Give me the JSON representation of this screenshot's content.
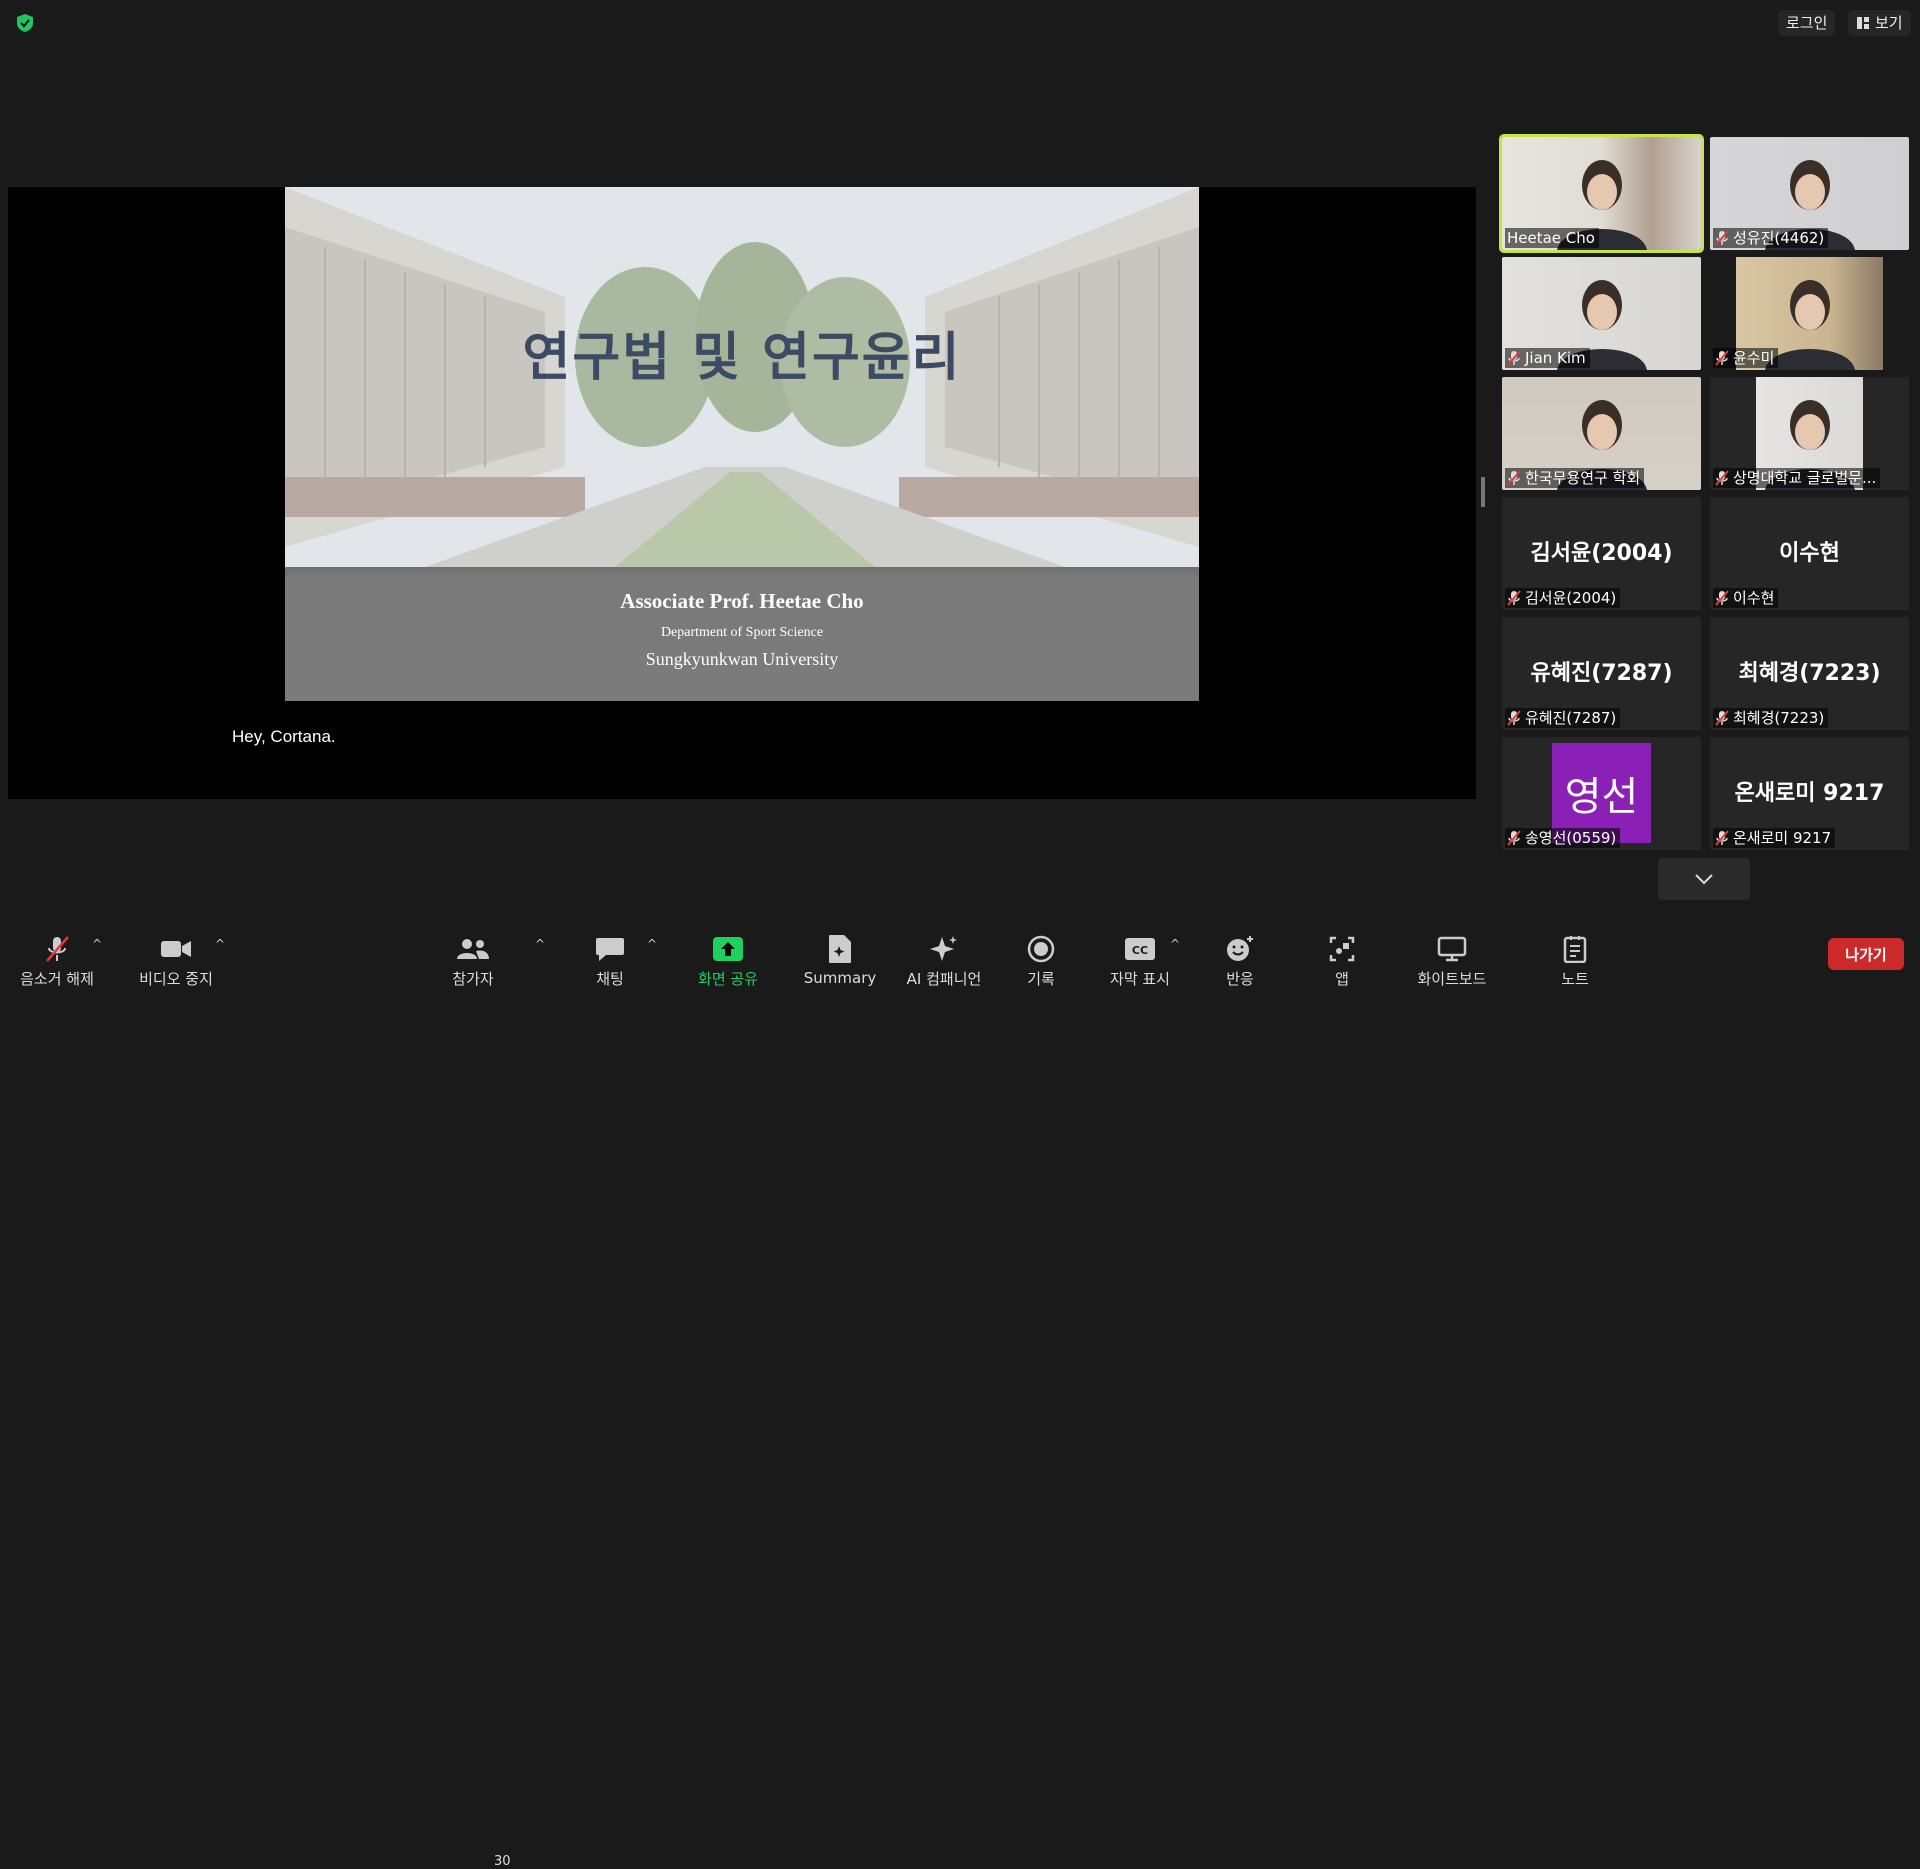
{
  "top": {
    "login_label": "로그인",
    "view_label": "보기"
  },
  "share": {
    "slide_title": "연구법 및 연구윤리",
    "prof": "Associate Prof. Heetae Cho",
    "dept": "Department of Sport Science",
    "univ": "Sungkyunkwan University",
    "caption": "Hey, Cortana."
  },
  "participants": [
    {
      "name": "Heetae Cho",
      "muted": false,
      "video": true,
      "active": true
    },
    {
      "name": "성유진(4462)",
      "muted": true,
      "video": true
    },
    {
      "name": "Jian Kim",
      "muted": true,
      "video": true
    },
    {
      "name": "윤수미",
      "muted": true,
      "video": true
    },
    {
      "name": "한국무용연구 학회",
      "muted": true,
      "video": true
    },
    {
      "name": "상명대학교 글로벌문...",
      "muted": true,
      "video": true
    },
    {
      "name": "김서윤(2004)",
      "display": "김서윤(2004)",
      "muted": true,
      "video": false
    },
    {
      "name": "이수현",
      "display": "이수현",
      "muted": true,
      "video": false
    },
    {
      "name": "유혜진(7287)",
      "display": "유혜진(7287)",
      "muted": true,
      "video": false
    },
    {
      "name": "최혜경(7223)",
      "display": "최혜경(7223)",
      "muted": true,
      "video": false
    },
    {
      "name": "송영선(0559)",
      "avatar_text": "영선",
      "muted": true,
      "video": false
    },
    {
      "name": "온새로미 9217",
      "display": "온새로미 9217",
      "muted": true,
      "video": false
    }
  ],
  "toolbar": {
    "audio": "음소거 해제",
    "video": "비디오 중지",
    "participants": "참가자",
    "participants_count": "30",
    "chat": "채팅",
    "share": "화면 공유",
    "summary": "Summary",
    "ai": "AI 컴패니언",
    "record": "기록",
    "captions": "자막 표시",
    "react": "반응",
    "apps": "앱",
    "whiteboard": "화이트보드",
    "notes": "노트",
    "leave": "나가기"
  },
  "colors": {
    "share_green": "#1fd05f",
    "active_border": "#c6e34a",
    "leave_red": "#cc2a2a",
    "avatar_purple": "#8a20b5"
  }
}
